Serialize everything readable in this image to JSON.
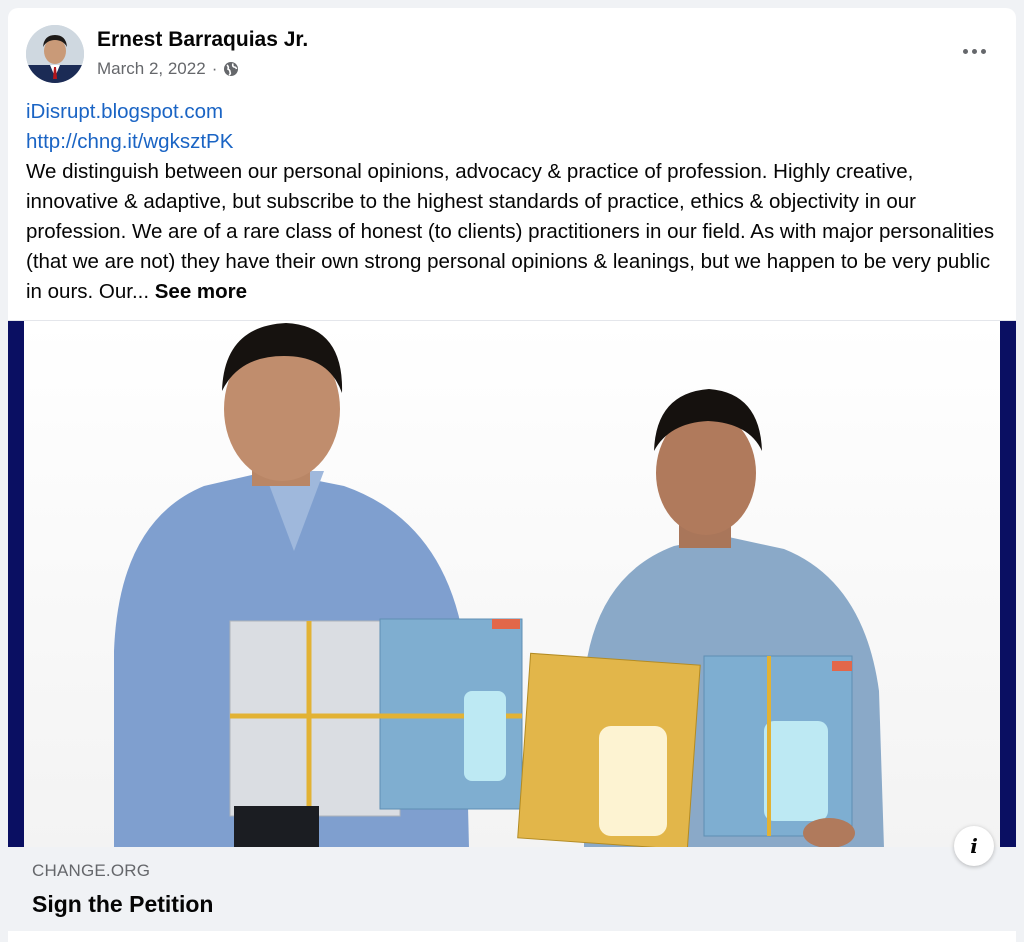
{
  "post": {
    "author_name": "Ernest Barraquias Jr.",
    "date": "March 2, 2022",
    "separator": "·",
    "audience_icon": "globe-icon",
    "more_icon": "more-options-icon",
    "link1": "iDisrupt.blogspot.com",
    "link2": "http://chng.it/wgksztPK",
    "body_text": "We distinguish between our personal opinions, advocacy & practice of profession. Highly creative, innovative & adaptive, but subscribe to the highest standards of practice, ethics & objectivity in our profession. We are of a rare class of honest (to clients) practitioners in our field. As with major personalities (that we are not) they have their own strong personal opinions & leanings, but we happen to be very public in ours. Our...",
    "see_more": "See more"
  },
  "link_preview": {
    "domain": "CHANGE.ORG",
    "title": "Sign the Petition",
    "info_label": "i"
  },
  "colors": {
    "link": "#1a64c4",
    "secondary_text": "#65676b",
    "card_bg": "#ffffff",
    "page_bg": "#f0f2f5",
    "image_edge": "#0a0f62"
  }
}
